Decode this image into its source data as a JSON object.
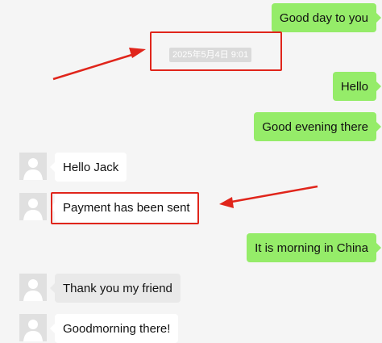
{
  "accent_colors": {
    "outgoing_bubble": "#95ec69",
    "incoming_bubble": "#ffffff",
    "annotation": "#e0251b"
  },
  "timestamp": "2025年5月4日 9:01",
  "messages": [
    {
      "direction": "outgoing",
      "text": "Good day to you"
    },
    {
      "direction": "outgoing",
      "text": "Hello"
    },
    {
      "direction": "outgoing",
      "text": "Good evening there"
    },
    {
      "direction": "incoming",
      "text": "Hello Jack",
      "avatar_icon": "default-user-avatar-icon"
    },
    {
      "direction": "incoming",
      "text": "Payment has been sent",
      "avatar_icon": "default-user-avatar-icon"
    },
    {
      "direction": "outgoing",
      "text": "It is morning in China"
    },
    {
      "direction": "incoming",
      "text": "Thank you my friend",
      "avatar_icon": "default-user-avatar-icon"
    },
    {
      "direction": "incoming",
      "text": "Goodmorning there!",
      "avatar_icon": "default-user-avatar-icon"
    }
  ],
  "annotations": [
    {
      "type": "highlight-with-arrow",
      "target": "timestamp"
    },
    {
      "type": "highlight-with-arrow",
      "target": "message-payment-has-been-sent"
    }
  ]
}
